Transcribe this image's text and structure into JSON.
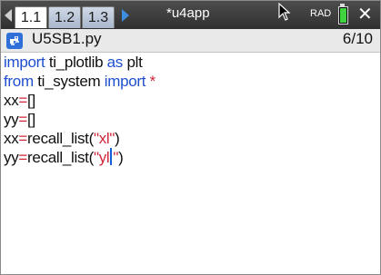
{
  "tabs": [
    {
      "label": "1.1",
      "active": true
    },
    {
      "label": "1.2",
      "active": false
    },
    {
      "label": "1.3",
      "active": false
    }
  ],
  "document_title": "*u4app",
  "status": {
    "angle_mode": "RAD",
    "battery_color": "#3fd43f"
  },
  "file": {
    "name": "U5SB1.py",
    "line_indicator": "6/10",
    "icon": "python-icon"
  },
  "code": {
    "line1": {
      "kw1": "import",
      "mod": " ti_plotlib ",
      "kw2": "as",
      "alias": " plt"
    },
    "line2": {
      "kw1": "from",
      "mod": " ti_system ",
      "kw2": "import",
      "star": " *"
    },
    "line3": {
      "var": "xx",
      "eq": "=",
      "brackets": "[]"
    },
    "line4": {
      "var": "yy",
      "eq": "=",
      "brackets": "[]"
    },
    "line5": {
      "var": "xx",
      "eq": "=",
      "fn": "recall_list(",
      "str": "\"xl\"",
      "close": ")"
    },
    "line6": {
      "var": "yy",
      "eq": "=",
      "fn": "recall_list(",
      "str_before": "\"yl",
      "str_after": "\"",
      "close": ")"
    }
  },
  "colors": {
    "keyword": "#1f4fcf",
    "operator": "#d0263a",
    "string": "#d0263a",
    "caret": "#1560d8"
  }
}
